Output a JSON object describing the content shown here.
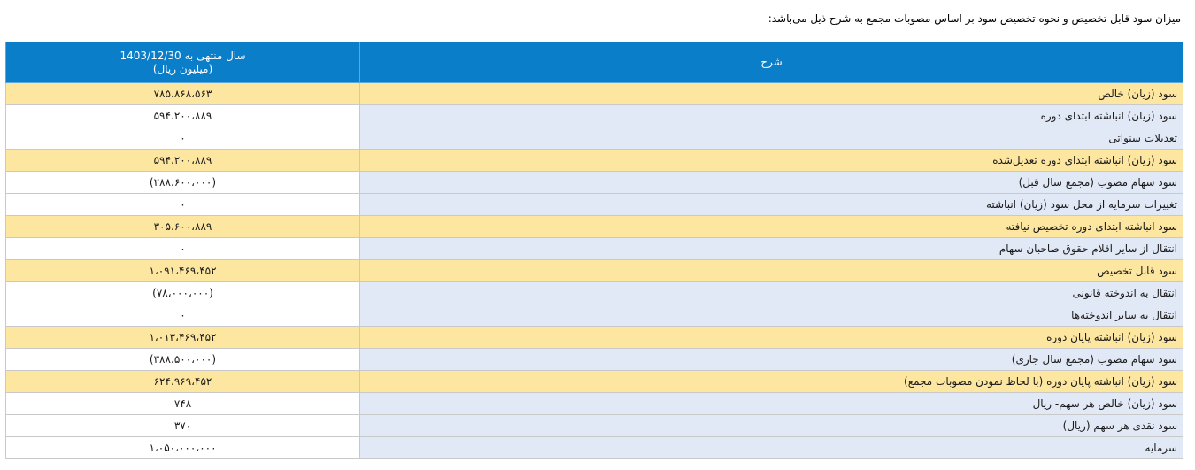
{
  "intro": "میزان سود قابل تخصیص و نحوه تخصیص سود بر اساس مصوبات مجمع به شرح ذیل می‌باشد:",
  "table": {
    "header_desc": "شرح",
    "header_val_line1": "سال منتهی به 1403/12/30",
    "header_val_line2": "(میلیون ریال)",
    "rows": [
      {
        "label": "سود (زیان) خالص",
        "value": "۷۸۵،۸۶۸،۵۶۳",
        "highlight": true,
        "negative": false
      },
      {
        "label": "سود (زیان) انباشته ابتدای دوره",
        "value": "۵۹۴،۲۰۰،۸۸۹",
        "highlight": false,
        "negative": false
      },
      {
        "label": "تعدیلات سنواتی",
        "value": "۰",
        "highlight": false,
        "negative": false
      },
      {
        "label": "سود (زیان) انباشته ابتدای دوره تعدیل‌شده",
        "value": "۵۹۴،۲۰۰،۸۸۹",
        "highlight": true,
        "negative": false
      },
      {
        "label": "سود سهام مصوب (مجمع سال قبل)",
        "value": "(۲۸۸،۶۰۰،۰۰۰)",
        "highlight": false,
        "negative": true
      },
      {
        "label": "تغییرات سرمایه از محل سود (زیان) انباشته",
        "value": "۰",
        "highlight": false,
        "negative": false
      },
      {
        "label": "سود انباشته ابتدای دوره تخصیص نیافته",
        "value": "۳۰۵،۶۰۰،۸۸۹",
        "highlight": true,
        "negative": false
      },
      {
        "label": "انتقال از سایر اقلام حقوق صاحبان سهام",
        "value": "۰",
        "highlight": false,
        "negative": false
      },
      {
        "label": "سود قابل تخصیص",
        "value": "۱،۰۹۱،۴۶۹،۴۵۲",
        "highlight": true,
        "negative": false
      },
      {
        "label": "انتقال به اندوخته قانونی",
        "value": "(۷۸،۰۰۰،۰۰۰)",
        "highlight": false,
        "negative": true
      },
      {
        "label": "انتقال به سایر اندوخته‌ها",
        "value": "۰",
        "highlight": false,
        "negative": false
      },
      {
        "label": "سود (زیان) انباشته پایان دوره",
        "value": "۱،۰۱۳،۴۶۹،۴۵۲",
        "highlight": true,
        "negative": false
      },
      {
        "label": "سود سهام مصوب (مجمع سال جاری)",
        "value": "(۳۸۸،۵۰۰،۰۰۰)",
        "highlight": false,
        "negative": true
      },
      {
        "label": "سود (زیان) انباشته پایان دوره (با لحاظ نمودن مصوبات مجمع)",
        "value": "۶۲۴،۹۶۹،۴۵۲",
        "highlight": true,
        "negative": false
      },
      {
        "label": "سود (زیان) خالص هر سهم- ریال",
        "value": "۷۴۸",
        "highlight": false,
        "negative": false
      },
      {
        "label": "سود نقدی هر سهم (ریال)",
        "value": "۳۷۰",
        "highlight": false,
        "negative": false
      },
      {
        "label": "سرمایه",
        "value": "۱،۰۵۰،۰۰۰،۰۰۰",
        "highlight": false,
        "negative": false
      }
    ]
  }
}
